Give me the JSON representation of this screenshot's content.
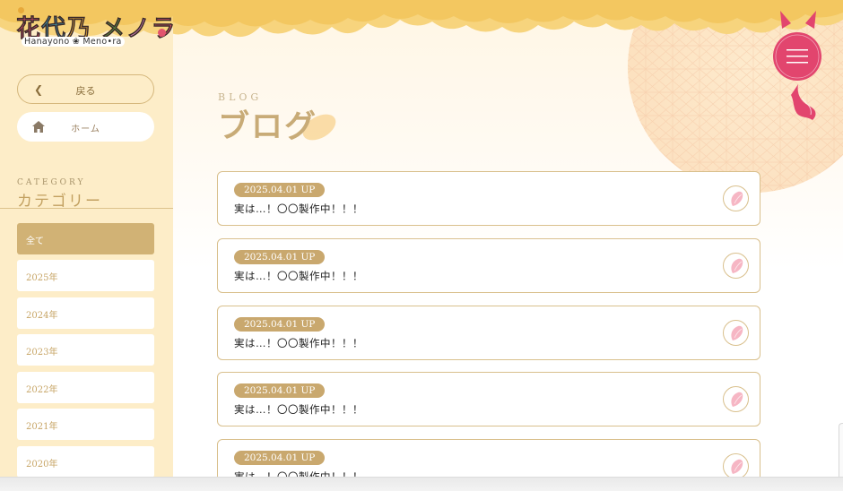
{
  "logo": {
    "main_chars": [
      "花",
      "代",
      "乃",
      " ",
      "メ",
      "ノ",
      "ラ"
    ],
    "sub": "Hanayono ❀ Meno•ra"
  },
  "sidebar": {
    "back_label": "戻る",
    "home_label": "ホーム",
    "category_en": "CATEGORY",
    "category_jp": "カテゴリー",
    "items": [
      {
        "label": "全て",
        "active": true
      },
      {
        "label": "2025年",
        "active": false
      },
      {
        "label": "2024年",
        "active": false
      },
      {
        "label": "2023年",
        "active": false
      },
      {
        "label": "2022年",
        "active": false
      },
      {
        "label": "2021年",
        "active": false
      },
      {
        "label": "2020年",
        "active": false
      }
    ]
  },
  "heading": {
    "en": "BLOG",
    "jp": "ブログ"
  },
  "posts": [
    {
      "date": "2025.04.01 UP",
      "title": "実は…！〇〇製作中！！！"
    },
    {
      "date": "2025.04.01 UP",
      "title": "実は…！〇〇製作中！！！"
    },
    {
      "date": "2025.04.01 UP",
      "title": "実は…！〇〇製作中！！！"
    },
    {
      "date": "2025.04.01 UP",
      "title": "実は…！〇〇製作中！！！"
    },
    {
      "date": "2025.04.01 UP",
      "title": "実は…！〇〇製作中！！！"
    }
  ],
  "colors": {
    "accent_gold": "#c9a86e",
    "sidebar_bg": "#fdedc8",
    "menu_pink": "#e2456e"
  },
  "icons": {
    "back": "chevron-left-icon",
    "home": "home-icon",
    "post": "petal-icon",
    "menu": "hamburger-menu-icon"
  }
}
